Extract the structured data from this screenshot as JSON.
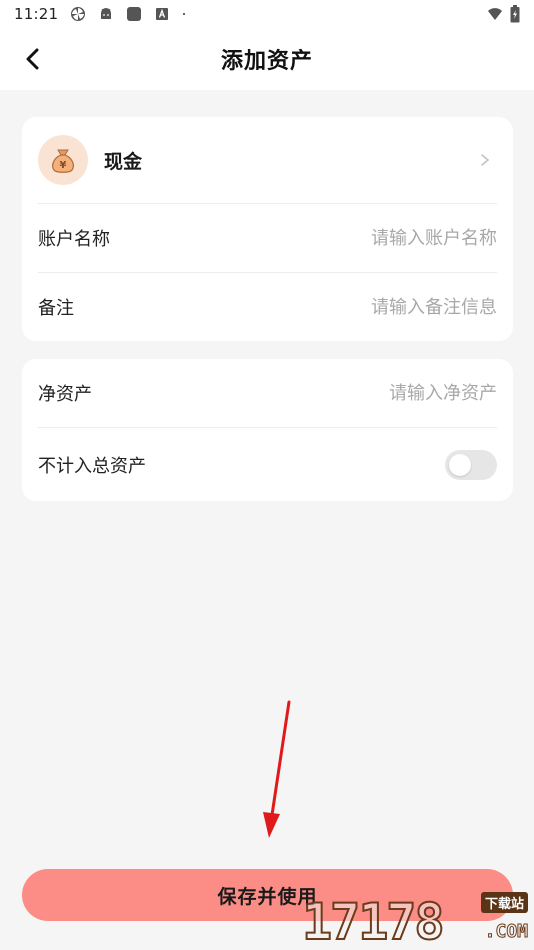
{
  "status_bar": {
    "time": "11:21",
    "left_icons": [
      "pinwheel-icon",
      "android-icon",
      "app-square-icon",
      "a-box-icon",
      "dot-icon"
    ],
    "right_icons": [
      "wifi-icon",
      "battery-icon"
    ]
  },
  "header": {
    "title": "添加资产",
    "back_icon": "chevron-left-icon"
  },
  "account_card": {
    "type": {
      "label": "现金",
      "icon": "money-bag-icon"
    },
    "name_row": {
      "label": "账户名称",
      "placeholder": "请输入账户名称",
      "value": ""
    },
    "note_row": {
      "label": "备注",
      "placeholder": "请输入备注信息",
      "value": ""
    }
  },
  "asset_card": {
    "net_row": {
      "label": "净资产",
      "placeholder": "请输入净资产",
      "value": ""
    },
    "exclude_row": {
      "label": "不计入总资产",
      "toggle_on": false
    }
  },
  "save_button": {
    "label": "保存并使用"
  },
  "watermark": {
    "digits": "17178",
    "badge": "下载站",
    "suffix": ".COM"
  },
  "colors": {
    "background": "#f5f5f5",
    "card": "#ffffff",
    "accent_button": "#fc8c86",
    "placeholder": "#a8a8a8",
    "toggle_off": "#e6e6e6",
    "annotation_arrow": "#e01a1a"
  }
}
